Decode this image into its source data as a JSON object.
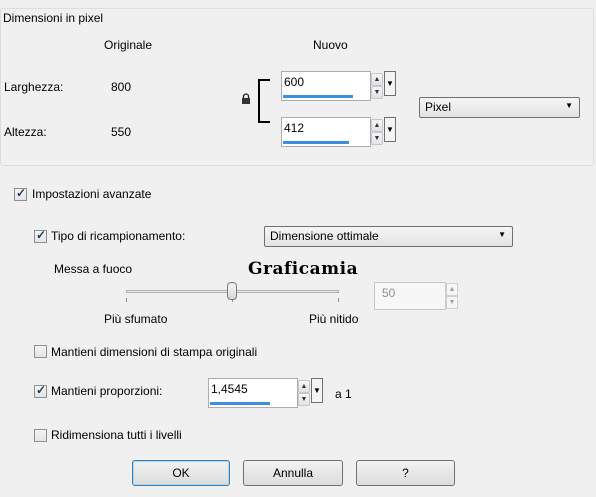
{
  "pixel_group": {
    "legend": "Dimensioni in pixel",
    "col_original": "Originale",
    "col_new": "Nuovo",
    "width_label": "Larghezza:",
    "width_original": "800",
    "height_label": "Altezza:",
    "height_original": "550",
    "width_new": "600",
    "height_new": "412",
    "unit": "Pixel",
    "link_icon": "lock-icon"
  },
  "advanced": {
    "label": "Impostazioni avanzate",
    "checked": true
  },
  "resample": {
    "label": "Tipo di ricampionamento:",
    "checked": true,
    "value": "Dimensione ottimale"
  },
  "sharpen": {
    "label": "Messa a fuoco",
    "left_label": "Più sfumato",
    "right_label": "Più nitido",
    "value": "50"
  },
  "watermark": "Graficamia",
  "options": {
    "keep_print_label": "Mantieni dimensioni di stampa originali",
    "keep_print_checked": false,
    "keep_ratio_label": "Mantieni proporzioni:",
    "keep_ratio_checked": true,
    "ratio_value": "1,4545",
    "ratio_suffix": "a 1",
    "resize_all_label": "Ridimensiona tutti i livelli",
    "resize_all_checked": false
  },
  "buttons": {
    "ok": "OK",
    "cancel": "Annulla",
    "help": "?"
  }
}
